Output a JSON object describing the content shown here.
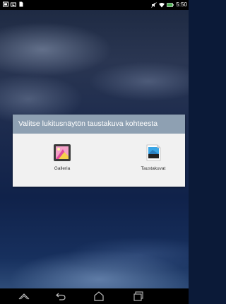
{
  "status_bar": {
    "time": "5:50",
    "left_icons": [
      "screenshot-icon",
      "keyboard-icon",
      "file-icon"
    ],
    "right_icons": [
      "no-sound-icon",
      "wifi-icon",
      "battery-icon"
    ]
  },
  "dialog": {
    "title": "Valitse lukitusnäytön taustakuva kohteesta",
    "options": [
      {
        "label": "Galleria",
        "icon": "gallery-icon"
      },
      {
        "label": "Taustakuvat",
        "icon": "wallpapers-icon"
      }
    ]
  },
  "nav_bar": {
    "buttons": [
      "up-icon",
      "back-icon",
      "home-icon",
      "recent-apps-icon"
    ]
  },
  "colors": {
    "dialog_header": "#8ea0b2",
    "dialog_body": "#f1f1f1",
    "bars": "#000000"
  }
}
